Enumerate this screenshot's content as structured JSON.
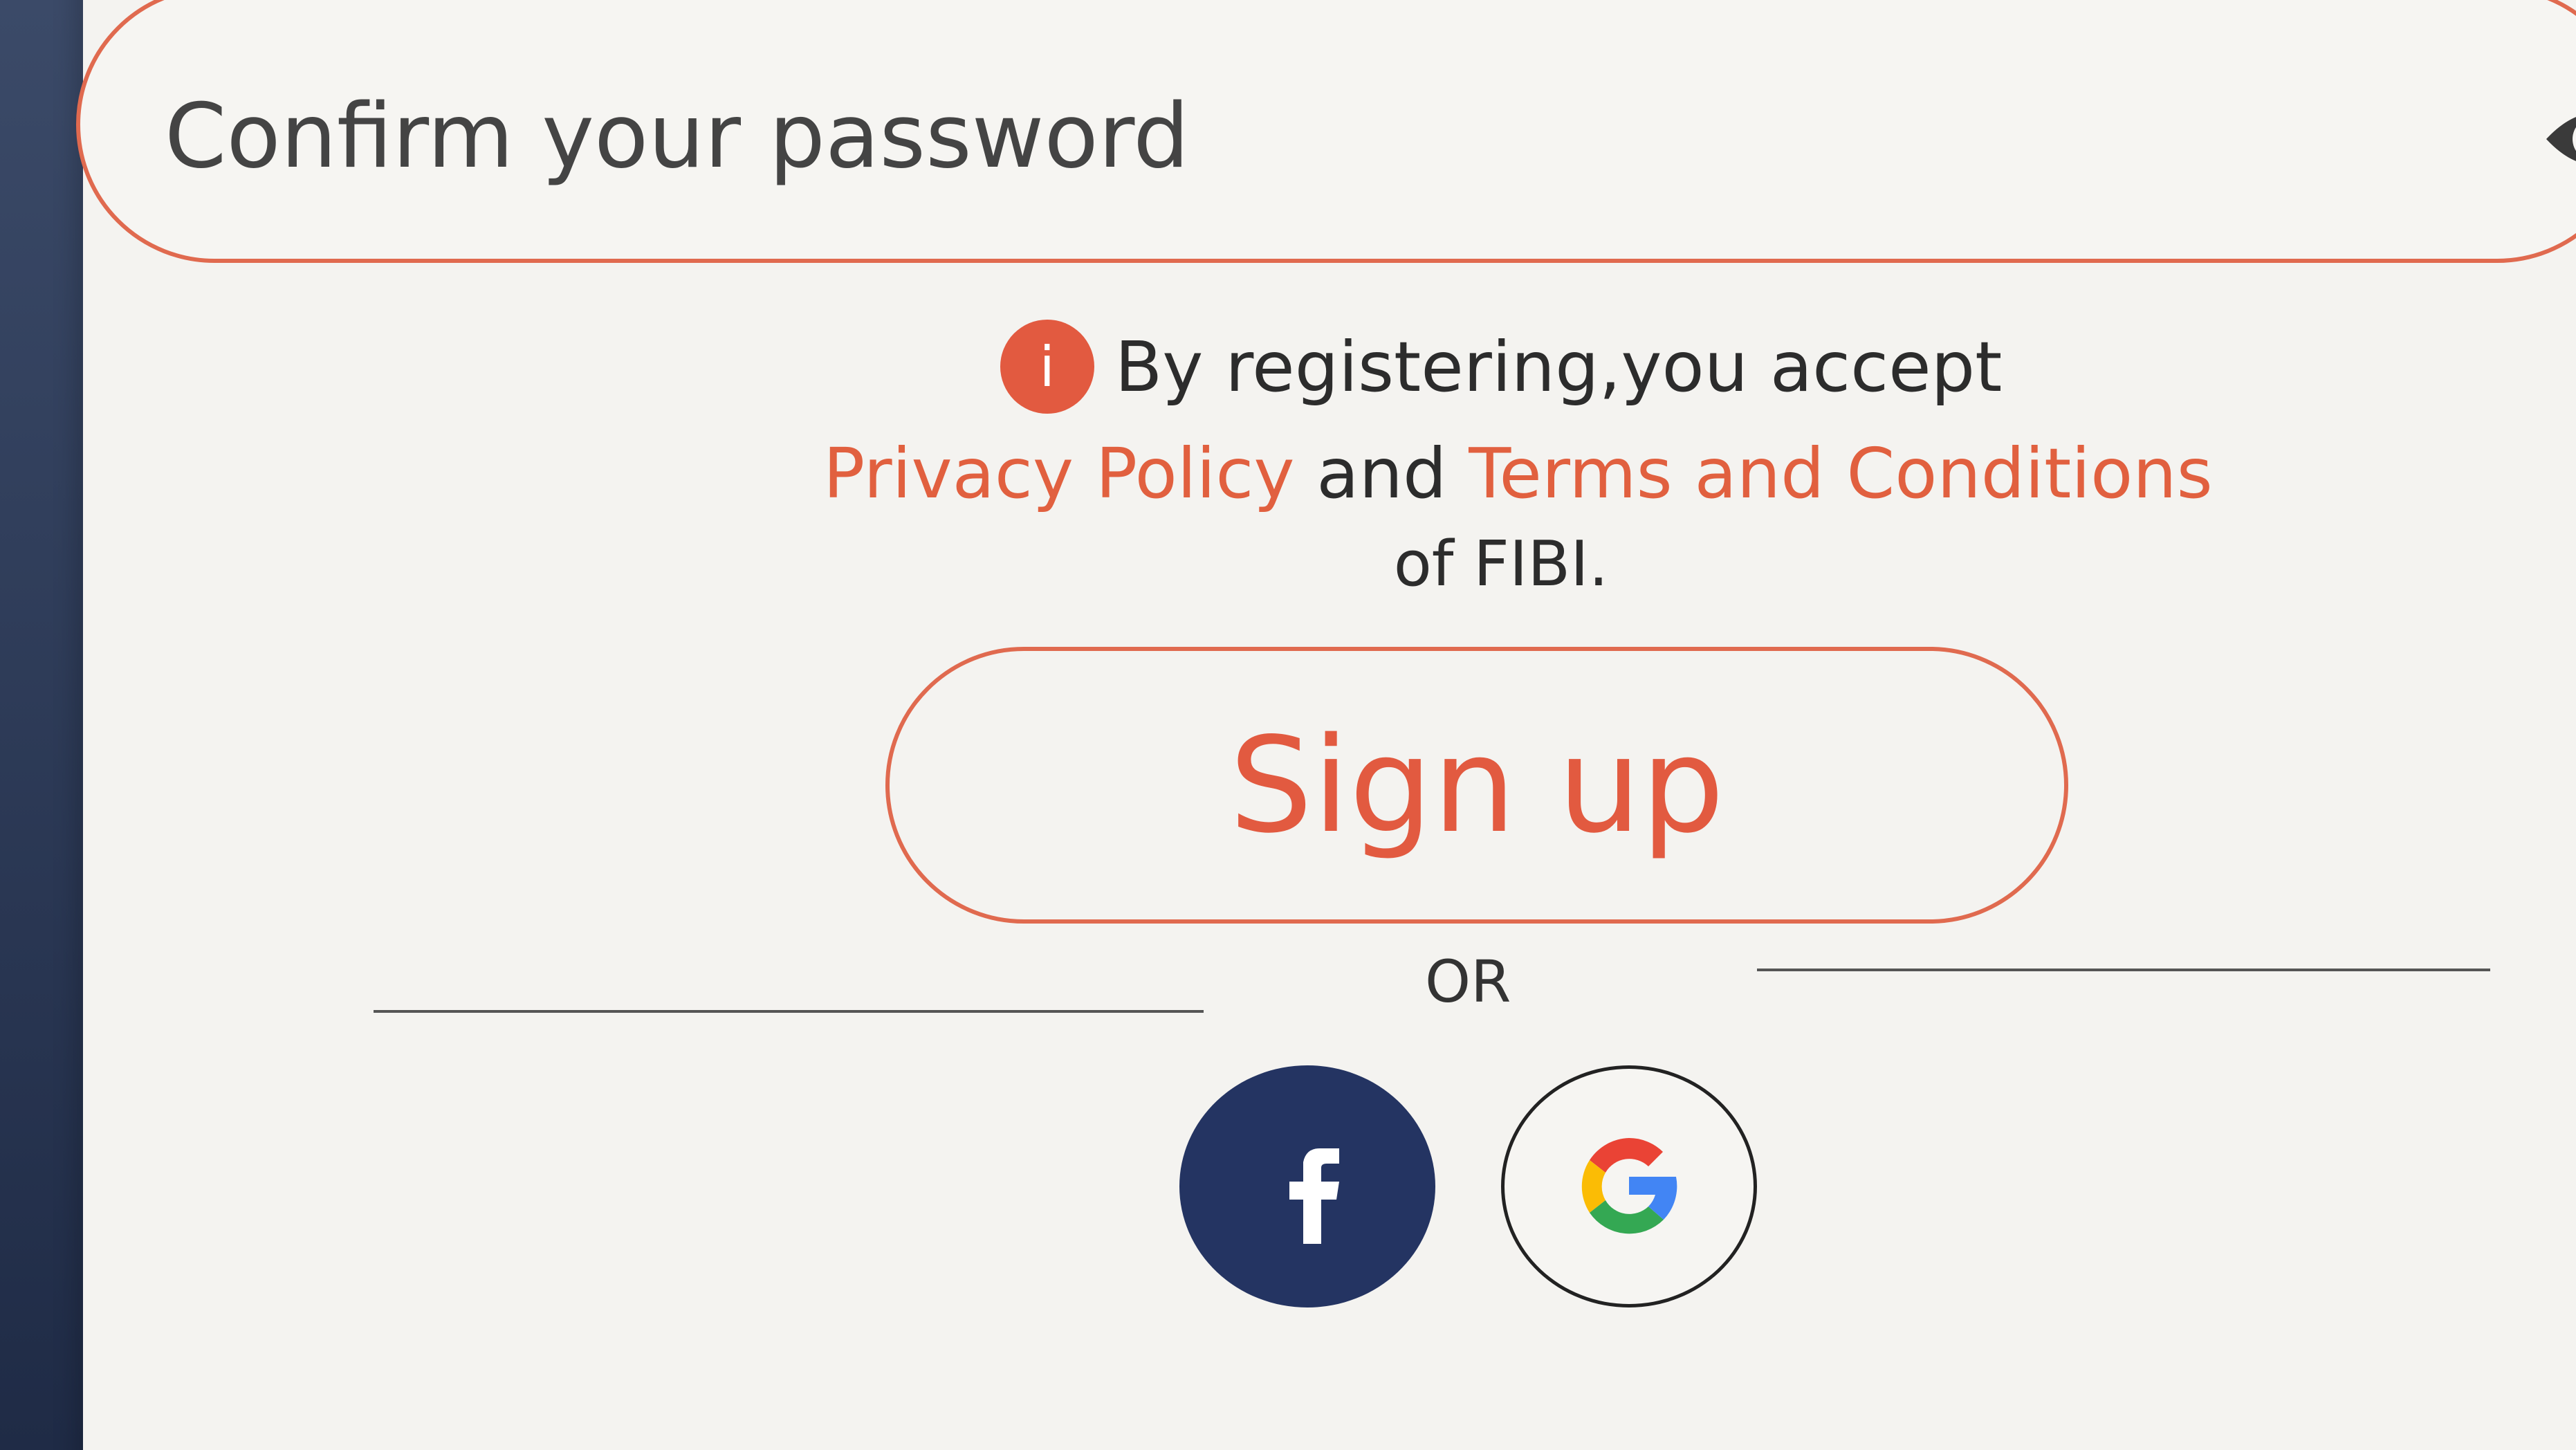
{
  "colors": {
    "accent": "#e1603f",
    "facebook": "#243462",
    "text": "#2c2c2c"
  },
  "password_field": {
    "placeholder": "Confirm your password",
    "toggle_icon": "eye-icon"
  },
  "notice": {
    "info_icon_glyph": "i",
    "line1": "By registering,you accept",
    "privacy_link": "Privacy Policy",
    "and_text": "and",
    "terms_link": "Terms and Conditions",
    "line3": "of FIBI."
  },
  "signup_button": {
    "label": "Sign up"
  },
  "divider": {
    "label": "OR"
  },
  "social": {
    "facebook_icon": "facebook-icon",
    "google_icon": "google-icon"
  }
}
